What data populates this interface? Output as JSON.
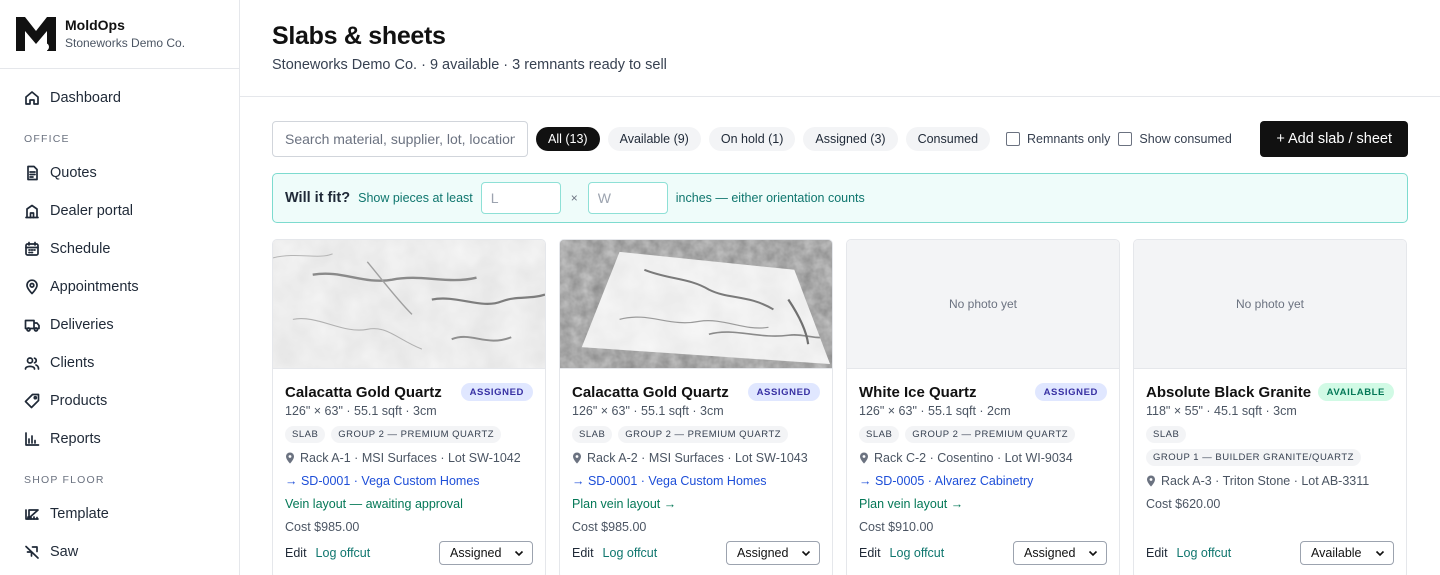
{
  "brand": {
    "name": "MoldOps",
    "company": "Stoneworks Demo Co."
  },
  "sidebar": {
    "top_items": [
      {
        "label": "Dashboard",
        "icon": "home-icon"
      }
    ],
    "office_label": "OFFICE",
    "office_items": [
      {
        "label": "Quotes",
        "icon": "document-icon"
      },
      {
        "label": "Dealer portal",
        "icon": "building-icon"
      },
      {
        "label": "Schedule",
        "icon": "calendar-icon"
      },
      {
        "label": "Appointments",
        "icon": "map-pin-icon"
      },
      {
        "label": "Deliveries",
        "icon": "truck-icon"
      },
      {
        "label": "Clients",
        "icon": "users-icon"
      },
      {
        "label": "Products",
        "icon": "tag-icon"
      },
      {
        "label": "Reports",
        "icon": "bar-chart-icon"
      }
    ],
    "shop_label": "SHOP FLOOR",
    "shop_items": [
      {
        "label": "Template",
        "icon": "ruler-icon"
      },
      {
        "label": "Saw",
        "icon": "saw-icon"
      }
    ]
  },
  "header": {
    "title": "Slabs & sheets",
    "subtitle": "Stoneworks Demo Co. · 9 available · 3 remnants ready to sell"
  },
  "toolbar": {
    "search_placeholder": "Search material, supplier, lot, location",
    "filters": [
      "All (13)",
      "Available (9)",
      "On hold (1)",
      "Assigned (3)",
      "Consumed"
    ],
    "active_filter": "All (13)",
    "remnants_label": "Remnants only",
    "show_consumed_label": "Show consumed",
    "add_label": "+ Add slab / sheet"
  },
  "fit": {
    "title": "Will it fit?",
    "lead": "Show pieces at least",
    "length_placeholder": "L",
    "times": "×",
    "width_placeholder": "W",
    "tail": "inches — either orientation counts"
  },
  "cards": [
    {
      "photo": "marble-closeup",
      "no_photo_text": "",
      "title": "Calacatta Gold Quartz",
      "status": "ASSIGNED",
      "dims": "126\" × 63\" · 55.1 sqft · 3cm",
      "tags": [
        "SLAB",
        "GROUP 2 — PREMIUM QUARTZ"
      ],
      "location": "Rack A-1 · MSI Surfaces · Lot SW-1042",
      "link": "→ SD-0001 · Vega Custom Homes",
      "action": "Vein layout — awaiting approval",
      "cost": "Cost $985.00",
      "edit": "Edit",
      "log": "Log offcut",
      "select": "Assigned"
    },
    {
      "photo": "marble-angled",
      "no_photo_text": "",
      "title": "Calacatta Gold Quartz",
      "status": "ASSIGNED",
      "dims": "126\" × 63\" · 55.1 sqft · 3cm",
      "tags": [
        "SLAB",
        "GROUP 2 — PREMIUM QUARTZ"
      ],
      "location": "Rack A-2 · MSI Surfaces · Lot SW-1043",
      "link": "→ SD-0001 · Vega Custom Homes",
      "action": "Plan vein layout →",
      "cost": "Cost $985.00",
      "edit": "Edit",
      "log": "Log offcut",
      "select": "Assigned"
    },
    {
      "photo": "none",
      "no_photo_text": "No photo yet",
      "title": "White Ice Quartz",
      "status": "ASSIGNED",
      "dims": "126\" × 63\" · 55.1 sqft · 2cm",
      "tags": [
        "SLAB",
        "GROUP 2 — PREMIUM QUARTZ"
      ],
      "location": "Rack C-2 · Cosentino · Lot WI-9034",
      "link": "→ SD-0005 · Alvarez Cabinetry",
      "action": "Plan vein layout →",
      "cost": "Cost $910.00",
      "edit": "Edit",
      "log": "Log offcut",
      "select": "Assigned"
    },
    {
      "photo": "none",
      "no_photo_text": "No photo yet",
      "title": "Absolute Black Granite",
      "status": "AVAILABLE",
      "dims": "118\" × 55\" · 45.1 sqft · 3cm",
      "tags": [
        "SLAB",
        "GROUP 1 — BUILDER GRANITE/QUARTZ"
      ],
      "location": "Rack A-3 · Triton Stone · Lot AB-3311",
      "link": "",
      "action": "",
      "cost": "Cost $620.00",
      "edit": "Edit",
      "log": "Log offcut",
      "select": "Available"
    }
  ]
}
